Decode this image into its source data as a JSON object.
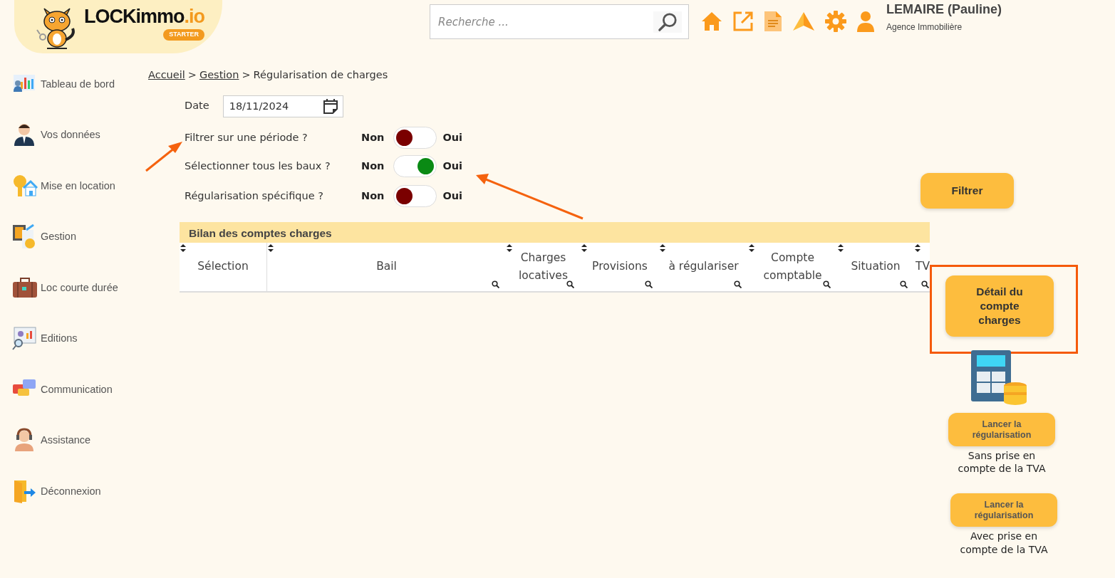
{
  "logo": {
    "brand": "LOCKimmo",
    "suffix": ".io",
    "badge": "STARTER"
  },
  "search": {
    "placeholder": "Recherche ..."
  },
  "user": {
    "name": "LEMAIRE (Pauline)",
    "role": "Agence Immobilière"
  },
  "sidebar": {
    "items": [
      {
        "label": "Tableau de bord",
        "kind": "dashboard"
      },
      {
        "label": "Vos données",
        "kind": "profile"
      },
      {
        "label": "Mise en location",
        "kind": "rental"
      },
      {
        "label": "Gestion",
        "kind": "management"
      },
      {
        "label": "Loc courte durée",
        "kind": "suitcase"
      },
      {
        "label": "Editions",
        "kind": "reports"
      },
      {
        "label": "Communication",
        "kind": "chat"
      },
      {
        "label": "Assistance",
        "kind": "support"
      },
      {
        "label": "Déconnexion",
        "kind": "logout"
      }
    ]
  },
  "breadcrumb": {
    "items": [
      {
        "label": "Accueil",
        "link": true
      },
      {
        "label": "Gestion",
        "link": true
      },
      {
        "label": "Régularisation de charges",
        "link": false
      }
    ],
    "separators": [
      ">",
      ">"
    ]
  },
  "date": {
    "label": "Date",
    "value": "18/11/2024"
  },
  "toggles": [
    {
      "label": "Filtrer sur une période ?",
      "off_label": "Non",
      "on_label": "Oui",
      "on": false
    },
    {
      "label": "Sélectionner tous les baux ?",
      "off_label": "Non",
      "on_label": "Oui",
      "on": true
    },
    {
      "label": "Régularisation spécifique ?",
      "off_label": "Non",
      "on_label": "Oui",
      "on": false
    }
  ],
  "table": {
    "title": "Bilan des comptes charges",
    "columns": [
      {
        "label": "Sélection",
        "search": false
      },
      {
        "label": "Bail",
        "search": true
      },
      {
        "label": "Charges locatives",
        "search": true
      },
      {
        "label": "Provisions",
        "search": true
      },
      {
        "label": "à régulariser",
        "search": true
      },
      {
        "label": "Compte comptable",
        "search": true
      },
      {
        "label": "Situation",
        "search": true
      },
      {
        "label": "TV",
        "search": true
      }
    ]
  },
  "filter_button": "Filtrer",
  "detail_button": {
    "label": "Détail du compte charges",
    "highlighted": true
  },
  "regularisation": [
    {
      "button": "Lancer la régularisation",
      "caption": "Sans prise en compte de la TVA"
    },
    {
      "button": "Lancer la régularisation",
      "caption": "Avec prise en compte de la TVA"
    }
  ]
}
